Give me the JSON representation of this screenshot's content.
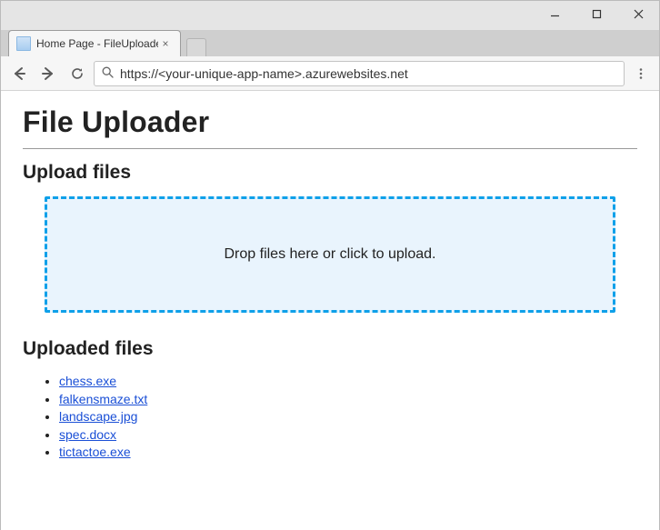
{
  "window": {
    "tab_title": "Home Page - FileUploade",
    "address_url": "https://<your-unique-app-name>.azurewebsites.net"
  },
  "page": {
    "title": "File Uploader",
    "upload_heading": "Upload files",
    "dropzone_text": "Drop files here or click to upload.",
    "uploaded_heading": "Uploaded files",
    "files": [
      "chess.exe",
      "falkensmaze.txt",
      "landscape.jpg",
      "spec.docx",
      "tictactoe.exe"
    ]
  }
}
